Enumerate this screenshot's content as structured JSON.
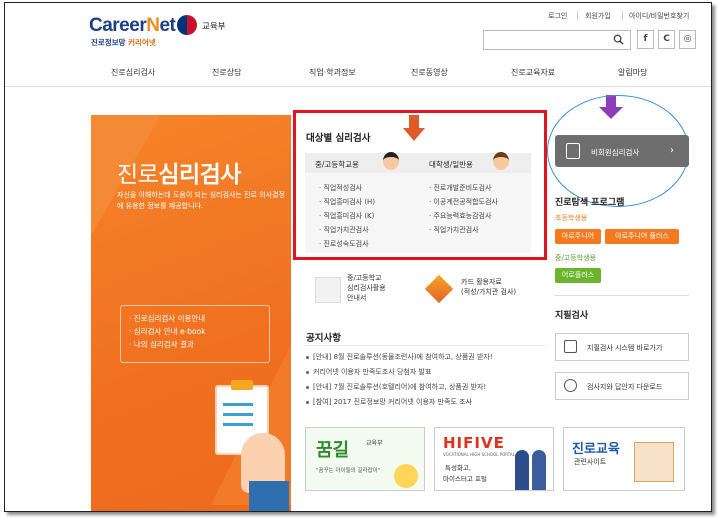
{
  "header": {
    "logo_main_a": "Career",
    "logo_main_n": "N",
    "logo_main_b": "et",
    "logo_sub_a": "진로정보망 ",
    "logo_sub_b": "커리어넷",
    "gov_name": "교육부",
    "util_links": [
      "로그인",
      "회원가입",
      "아이디/비밀번호찾기"
    ],
    "sns": [
      "f",
      "C",
      "◎"
    ]
  },
  "nav": [
    "진로심리검사",
    "진로상담",
    "직업·학과정보",
    "진로동영상",
    "진로교육자료",
    "알림마당"
  ],
  "banner": {
    "title_a": "진로",
    "title_b": "심리검사",
    "desc": "자신을 이해하는데 도움이 되는 심리검사는 진로 의사결정에 유용한 정보를 제공합니다.",
    "links": [
      "진로심리검사 이용안내",
      "심리검사 안내 e-book",
      "나의 심리검사 결과"
    ]
  },
  "target_tests": {
    "title": "대상별 심리검사",
    "col1_head": "중/고등학교용",
    "col2_head": "대학생/일반용",
    "col1": [
      "직업적성검사",
      "직업흥미검사 (H)",
      "직업흥미검사 (K)",
      "직업가치관검사",
      "진로성숙도검사"
    ],
    "col2": [
      "진로개발준비도검사",
      "이공계전공적합도검사",
      "주요능력효능감검사",
      "직업가치관검사"
    ]
  },
  "nonmember": {
    "label": "비회원심리검사",
    "chevron": "›"
  },
  "explore": {
    "title": "진로탐색 프로그램",
    "elem_label": "초등학생용",
    "elem_buttons": [
      "아로주니어",
      "아로주니어 플러스"
    ],
    "mid_label": "중/고등학생용",
    "mid_buttons": [
      "어로플러스"
    ]
  },
  "paper_test": {
    "title": "지필검사",
    "items": [
      "지필검사 시스템 바로가기",
      "검사지와 답안지 다운로드"
    ]
  },
  "mid_cards": [
    {
      "lines": [
        "중/고등학교",
        "심리검사활용",
        "안내서"
      ]
    },
    {
      "lines": [
        "카드 활용자료",
        "(적성/가치관 검사)"
      ]
    }
  ],
  "notices": {
    "title": "공지사항",
    "items": [
      "[안내] 8월 진로솔루션(동물조련사)에 참여하고, 상품권 받자!",
      "커리어넷 이용자 만족도조사 당첨자 발표",
      "[안내] 7월 진로솔루션(호텔리어)에 참여하고, 상품권 받자!",
      "[참여] 2017 진로정보망 커리어넷 이용자 만족도 조사"
    ]
  },
  "bottom_banners": {
    "ggumgil_title": "꿈길",
    "ggumgil_org": "교육부",
    "ggumgil_slogan": "\"꿈꾸는 아이들의 길라잡이\"",
    "hifive_title": "HIFIVE",
    "hifive_sub": "VOCATIONAL HIGH SCHOOL PORTAL",
    "hifive_desc_1": "특성화고,",
    "hifive_desc_2": "마이스터고 포털",
    "edu_title": "진로교육",
    "edu_sub": "관련사이트"
  },
  "colors": {
    "brand_orange": "#f07020",
    "brand_navy": "#1b3f88",
    "annotation_red": "#e3141f",
    "annotation_purple": "#8e3cb8",
    "annotation_blue": "#3b8fd8",
    "pill_orange": "#f47a20",
    "pill_green": "#6bb42c"
  }
}
